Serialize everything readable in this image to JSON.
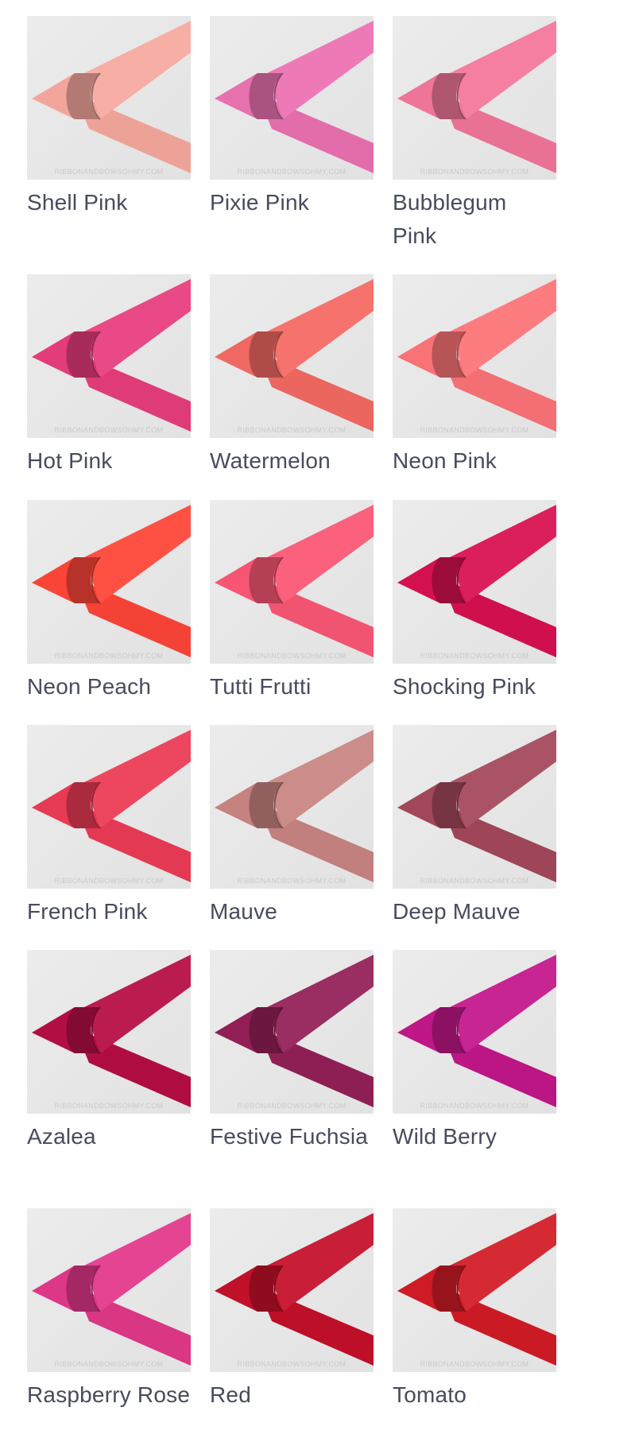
{
  "watermark": "RIBBONANDBOWSOHMY.COM",
  "swatches": [
    {
      "name": "Shell Pink",
      "color": "#f7a99e",
      "icon": "ribbon-swatch-image"
    },
    {
      "name": "Pixie Pink",
      "color": "#ec72b2",
      "icon": "ribbon-swatch-image"
    },
    {
      "name": "Bubblegum Pink",
      "color": "#f3779a",
      "icon": "ribbon-swatch-image"
    },
    {
      "name": "Hot Pink",
      "color": "#e83d7e",
      "icon": "ribbon-swatch-image"
    },
    {
      "name": "Watermelon",
      "color": "#f46a63",
      "icon": "ribbon-swatch-image"
    },
    {
      "name": "Neon Pink",
      "color": "#fd7478",
      "icon": "ribbon-swatch-image"
    },
    {
      "name": "Neon Peach",
      "color": "#fe4638",
      "icon": "ribbon-swatch-image"
    },
    {
      "name": "Tutti Frutti",
      "color": "#fb5775",
      "icon": "ribbon-swatch-image"
    },
    {
      "name": "Shocking Pink",
      "color": "#d81150",
      "icon": "ribbon-swatch-image"
    },
    {
      "name": "French Pink",
      "color": "#ec3b56",
      "icon": "ribbon-swatch-image"
    },
    {
      "name": "Mauve",
      "color": "#c98582",
      "icon": "ribbon-swatch-image"
    },
    {
      "name": "Deep Mauve",
      "color": "#a5485c",
      "icon": "ribbon-swatch-image"
    },
    {
      "name": "Azalea",
      "color": "#b60e45",
      "icon": "ribbon-swatch-image"
    },
    {
      "name": "Festive Fuchsia",
      "color": "#942057",
      "icon": "ribbon-swatch-image"
    },
    {
      "name": "Wild Berry",
      "color": "#c3178a",
      "icon": "ribbon-swatch-image"
    },
    {
      "name": "Raspberry Rose",
      "color": "#e2388a",
      "icon": "ribbon-swatch-image"
    },
    {
      "name": "Red",
      "color": "#c5102a",
      "icon": "ribbon-swatch-image"
    },
    {
      "name": "Tomato",
      "color": "#d21c27",
      "icon": "ribbon-swatch-image"
    }
  ]
}
